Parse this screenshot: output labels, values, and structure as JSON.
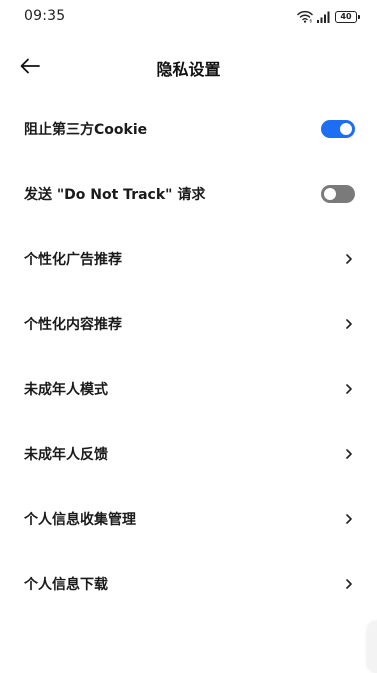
{
  "status_bar": {
    "time": "09:35",
    "battery": "40",
    "icons": [
      "wifi-icon",
      "signal-icon",
      "battery-icon"
    ]
  },
  "header": {
    "title": "隐私设置",
    "back_icon": "arrow-left-icon"
  },
  "settings": {
    "items": [
      {
        "label": "阻止第三方Cookie",
        "control": "toggle",
        "state": "on"
      },
      {
        "label": "发送 \"Do Not Track\" 请求",
        "control": "toggle",
        "state": "off"
      },
      {
        "label": "个性化广告推荐",
        "control": "chevron"
      },
      {
        "label": "个性化内容推荐",
        "control": "chevron"
      },
      {
        "label": "未成年人模式",
        "control": "chevron"
      },
      {
        "label": "未成年人反馈",
        "control": "chevron"
      },
      {
        "label": "个人信息收集管理",
        "control": "chevron"
      },
      {
        "label": "个人信息下载",
        "control": "chevron"
      }
    ]
  },
  "colors": {
    "toggle_on": "#1d6ef2",
    "toggle_off": "#7a7a7a",
    "background": "#ffffff",
    "text": "#1a1a1a"
  }
}
